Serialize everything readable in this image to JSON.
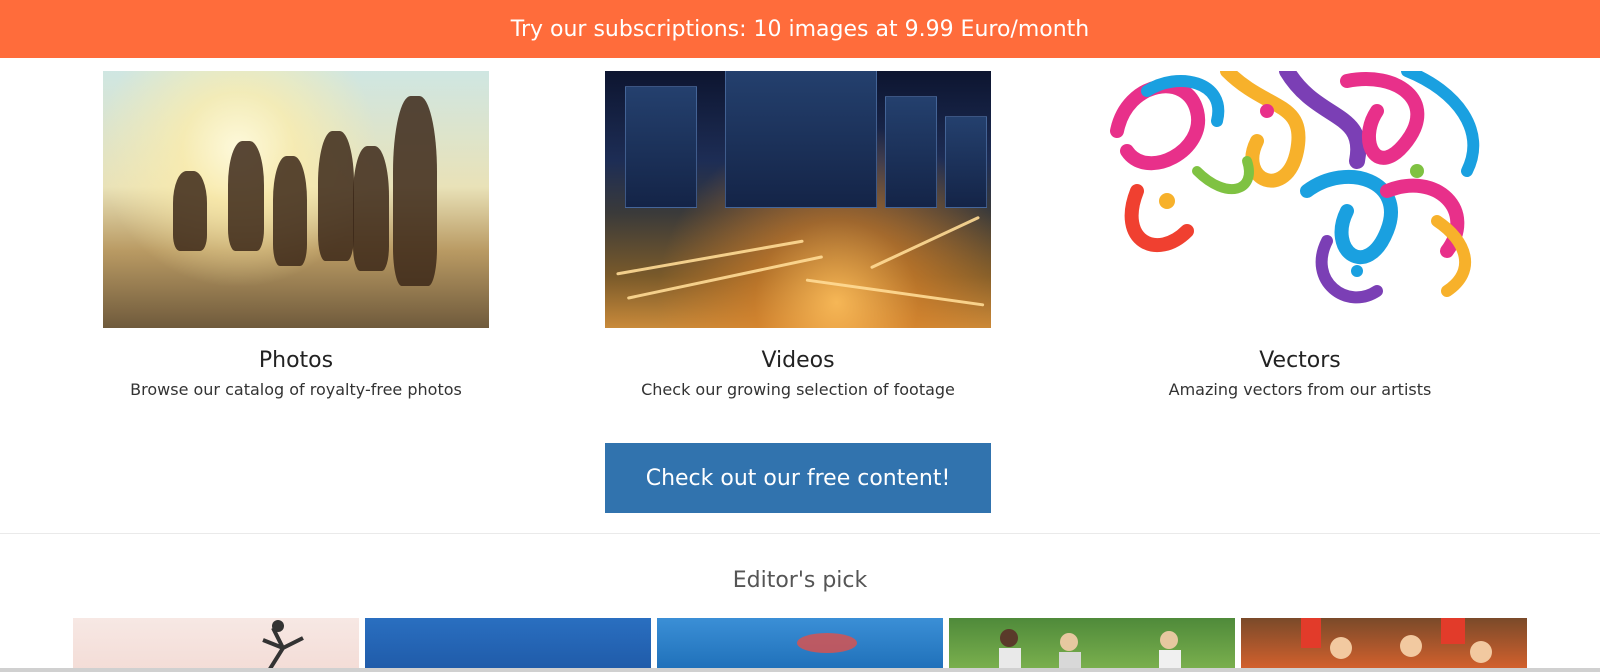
{
  "banner": {
    "text": "Try our subscriptions: 10 images at 9.99 Euro/month",
    "color": "#ff6c3b"
  },
  "categories": [
    {
      "title": "Photos",
      "description": "Browse our catalog of royalty-free photos",
      "image": "beach-jumping-friends-image"
    },
    {
      "title": "Videos",
      "description": "Check our growing selection of footage",
      "image": "city-night-traffic-image"
    },
    {
      "title": "Vectors",
      "description": "Amazing vectors from our artists",
      "image": "colorful-swirls-image"
    }
  ],
  "cta": {
    "label": "Check out our free content!",
    "color": "#3173ae"
  },
  "editors_pick": {
    "heading": "Editor's pick",
    "items": [
      {
        "image": "dancer-image"
      },
      {
        "image": "pool-swimmer-image"
      },
      {
        "image": "underwater-swimmer-image"
      },
      {
        "image": "outdoor-group-image"
      },
      {
        "image": "fans-cheering-image"
      }
    ]
  }
}
